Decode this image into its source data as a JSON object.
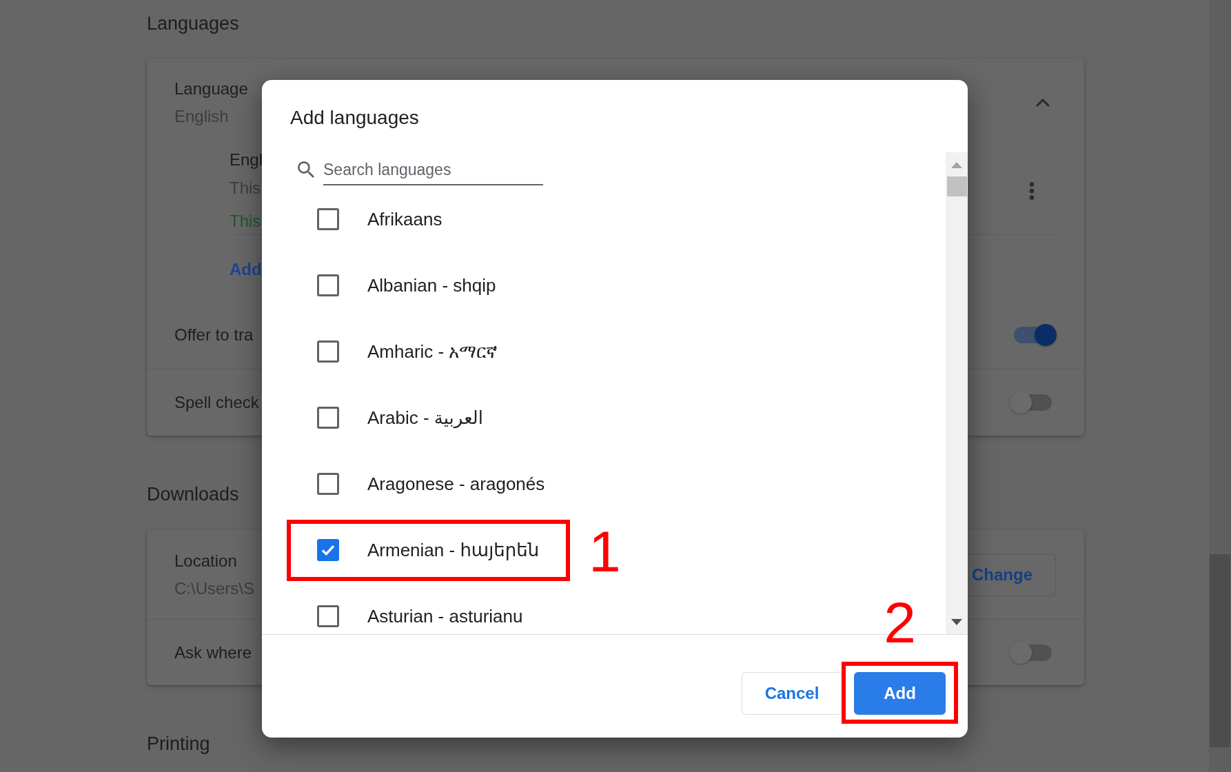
{
  "settings": {
    "languages": {
      "heading": "Languages",
      "language": {
        "label": "Language",
        "value": "English",
        "expanded": true
      },
      "entry": {
        "name": "Engl",
        "description": "This",
        "status": "This"
      },
      "add_link": "Add",
      "offer_translate": {
        "label": "Offer to tra",
        "on": true
      },
      "spell_check": {
        "label": "Spell check",
        "on": false
      }
    },
    "downloads": {
      "heading": "Downloads",
      "location": {
        "label": "Location",
        "value": "C:\\Users\\S",
        "button": "Change"
      },
      "ask_where": {
        "label": "Ask where",
        "on": false
      }
    },
    "printing": {
      "heading": "Printing"
    }
  },
  "dialog": {
    "title": "Add languages",
    "search": {
      "placeholder": "Search languages"
    },
    "languages": [
      {
        "label": "Afrikaans",
        "checked": false
      },
      {
        "label": "Albanian - shqip",
        "checked": false
      },
      {
        "label": "Amharic - አማርኛ",
        "checked": false
      },
      {
        "label": "Arabic - العربية",
        "checked": false
      },
      {
        "label": "Aragonese - aragonés",
        "checked": false
      },
      {
        "label": "Armenian - հայերեն",
        "checked": true,
        "annotation": "1"
      },
      {
        "label": "Asturian - asturianu",
        "checked": false
      }
    ],
    "buttons": [
      {
        "label": "Cancel",
        "kind": "secondary"
      },
      {
        "label": "Add",
        "kind": "primary",
        "annotation": "2"
      }
    ]
  }
}
